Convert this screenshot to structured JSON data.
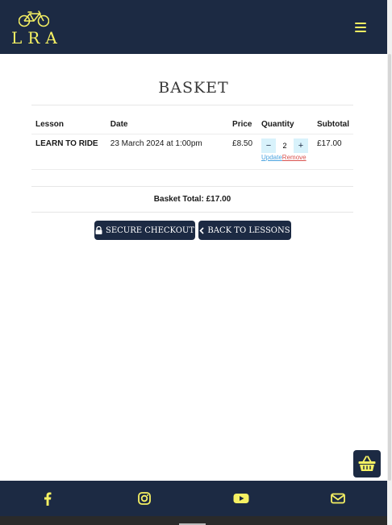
{
  "header": {
    "logo_text": "LRA",
    "menu_icon": "hamburger-icon",
    "colors": {
      "navy": "#1c2a43",
      "accent": "#f6f163"
    }
  },
  "page": {
    "title": "BASKET"
  },
  "table": {
    "headers": [
      "Lesson",
      "Date",
      "Price",
      "Quantity",
      "Subtotal"
    ],
    "rows": [
      {
        "lesson": "LEARN TO RIDE",
        "date": "23 March 2024 at 1:00pm",
        "price": "£8.50",
        "quantity": "2",
        "update_label": "Update",
        "remove_label": "Remove",
        "subtotal": "£17.00"
      }
    ]
  },
  "basket_total": "Basket Total: £17.00",
  "buttons": {
    "checkout": "SECURE CHECKOUT",
    "back": "BACK TO LESSONS"
  },
  "footer": {
    "icons": [
      "facebook-icon",
      "instagram-icon",
      "youtube-icon",
      "envelope-icon"
    ]
  }
}
